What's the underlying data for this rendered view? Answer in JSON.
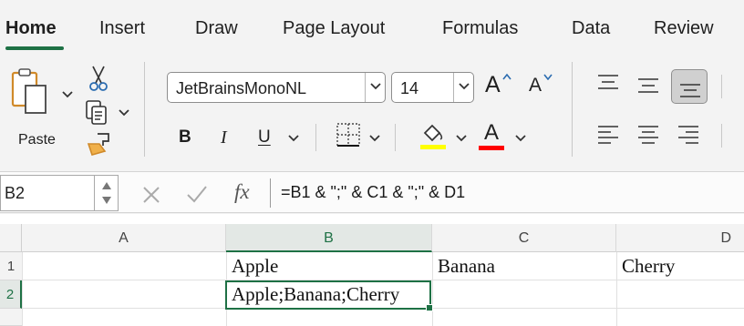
{
  "ribbon": {
    "tabs": [
      {
        "label": "Home",
        "active": true
      },
      {
        "label": "Insert"
      },
      {
        "label": "Draw"
      },
      {
        "label": "Page Layout"
      },
      {
        "label": "Formulas"
      },
      {
        "label": "Data"
      },
      {
        "label": "Review"
      }
    ],
    "clipboard": {
      "paste_label": "Paste"
    },
    "font": {
      "family": "JetBrainsMonoNL",
      "size": "14"
    },
    "format_labels": {
      "bold": "B",
      "italic": "I",
      "underline": "U",
      "font_color": "A",
      "increase_size": "A",
      "decrease_size": "A"
    },
    "colors": {
      "accent": "#1e7145",
      "highlight": "#ffff00",
      "font_color": "#ff0000"
    }
  },
  "formula_bar": {
    "name_box": "B2",
    "fx": "fx",
    "formula": "=B1 & \";\" & C1 & \";\" & D1"
  },
  "sheet": {
    "columns": [
      "A",
      "B",
      "C",
      "D"
    ],
    "selected_column": "B",
    "rows": [
      "1",
      "2"
    ],
    "selected_row": "2",
    "cells": {
      "B1": "Apple",
      "C1": "Banana",
      "D1": "Cherry",
      "B2": "Apple;Banana;Cherry"
    },
    "active_cell": "B2"
  }
}
